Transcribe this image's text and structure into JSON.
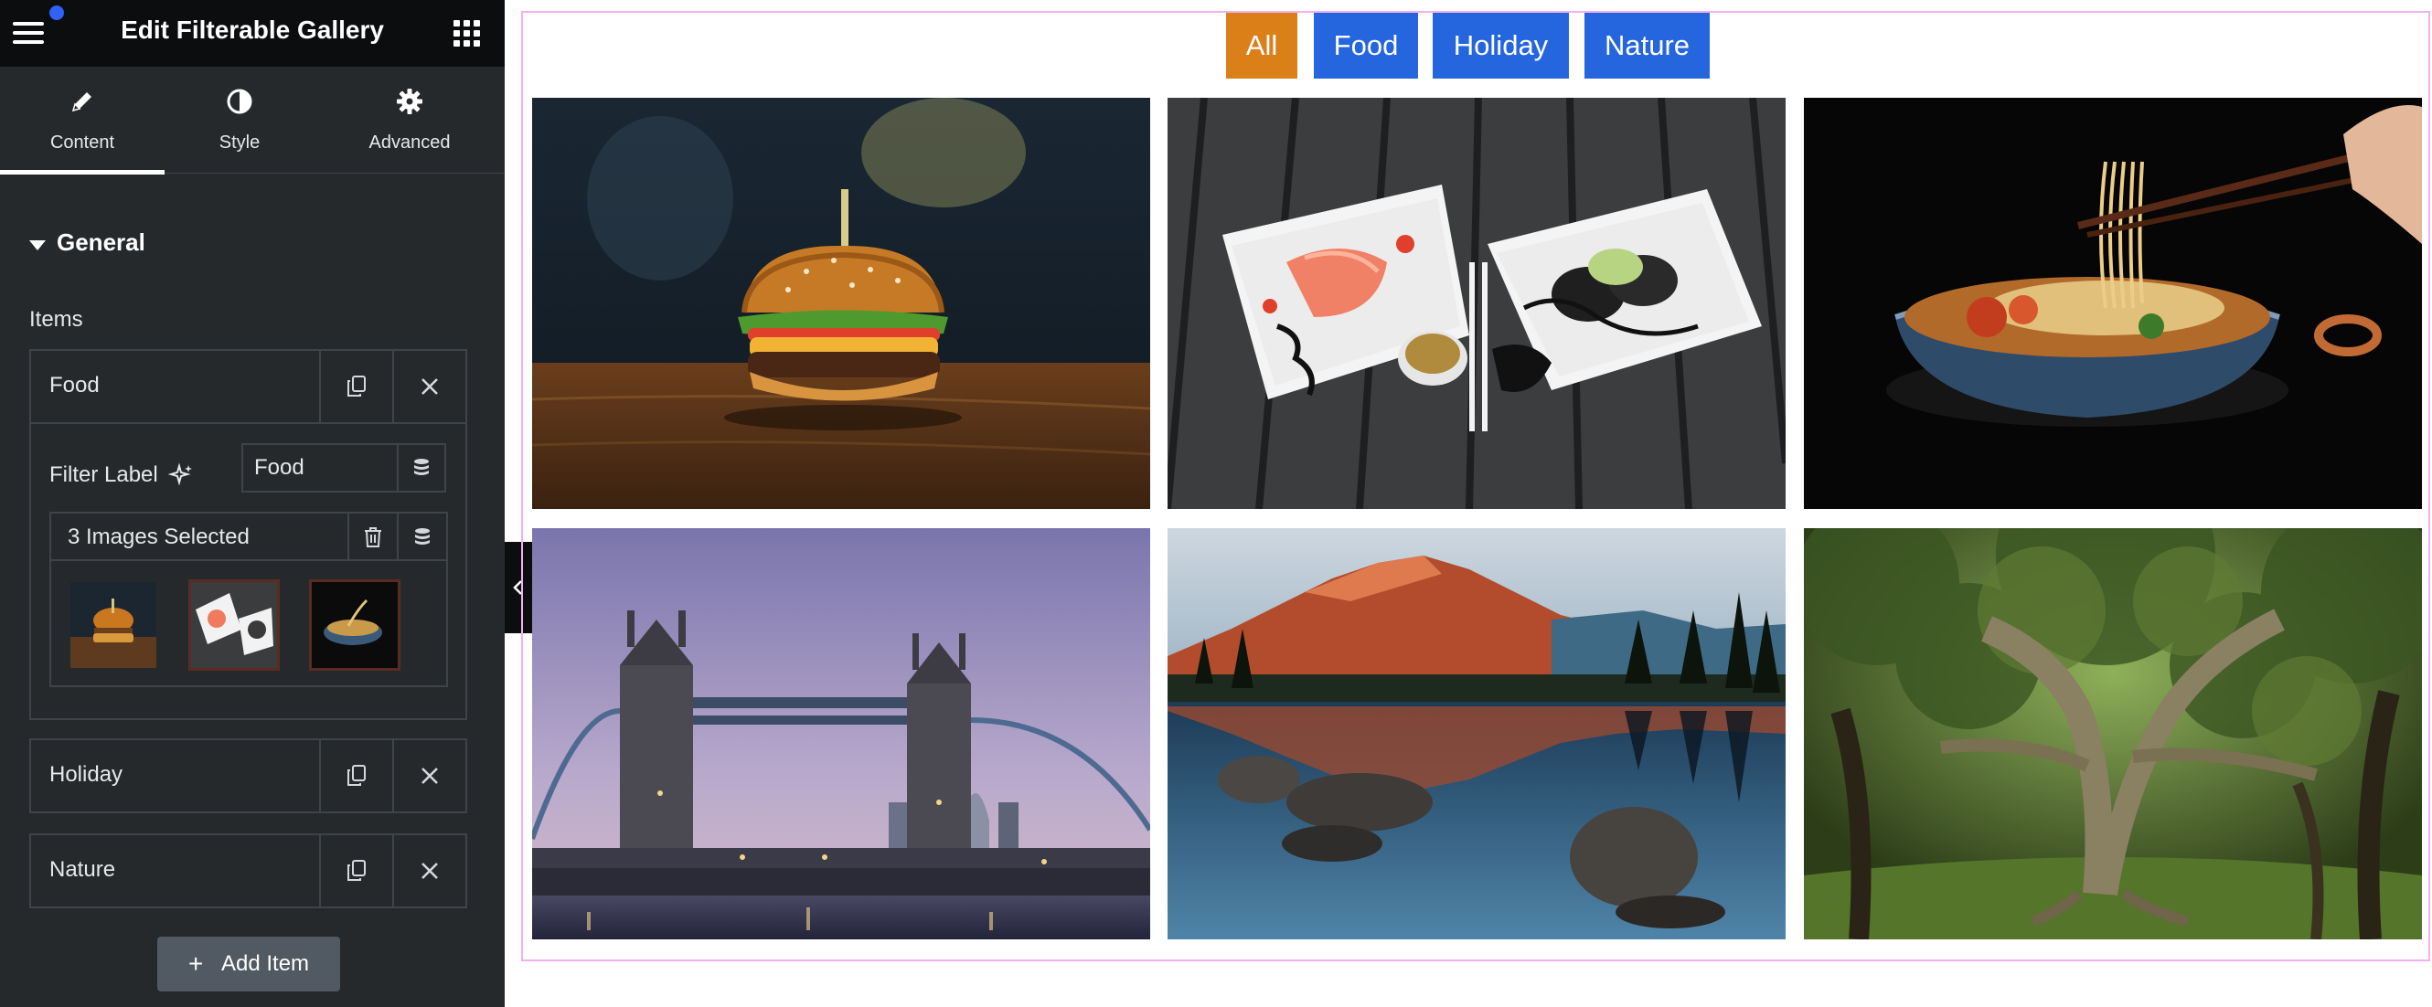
{
  "topbar": {
    "title": "Edit Filterable Gallery",
    "menu_icon": "hamburger-menu-icon",
    "apps_icon": "grid-apps-icon",
    "notification_color": "#2f62f5"
  },
  "tabs": [
    {
      "label": "Content",
      "icon": "pencil-icon",
      "active": true
    },
    {
      "label": "Style",
      "icon": "contrast-icon",
      "active": false
    },
    {
      "label": "Advanced",
      "icon": "gear-icon",
      "active": false
    }
  ],
  "section": {
    "title": "General",
    "expanded": true
  },
  "items_label": "Items",
  "repeater": [
    {
      "title": "Food",
      "expanded": true,
      "filter_label_caption": "Filter Label",
      "filter_label_value": "Food",
      "media_count_text": "3 Images Selected"
    },
    {
      "title": "Holiday",
      "expanded": false
    },
    {
      "title": "Nature",
      "expanded": false
    }
  ],
  "add_item_label": "Add Item",
  "filters": [
    {
      "label": "All",
      "active": true
    },
    {
      "label": "Food",
      "active": false
    },
    {
      "label": "Holiday",
      "active": false
    },
    {
      "label": "Nature",
      "active": false
    }
  ],
  "gallery": [
    {
      "subject": "burger-image",
      "category": "Food"
    },
    {
      "subject": "sushi-image",
      "category": "Food"
    },
    {
      "subject": "noodles-image",
      "category": "Food"
    },
    {
      "subject": "tower-bridge-image",
      "category": "Holiday"
    },
    {
      "subject": "mountain-lake-image",
      "category": "Nature"
    },
    {
      "subject": "forest-tree-image",
      "category": "Nature"
    }
  ],
  "colors": {
    "sidebar_bg": "#26292c",
    "topbar_bg": "#0c0d0e",
    "active_filter": "#db7f18",
    "inactive_filter": "#2566de",
    "canvas_outline": "#f2b1ee"
  }
}
